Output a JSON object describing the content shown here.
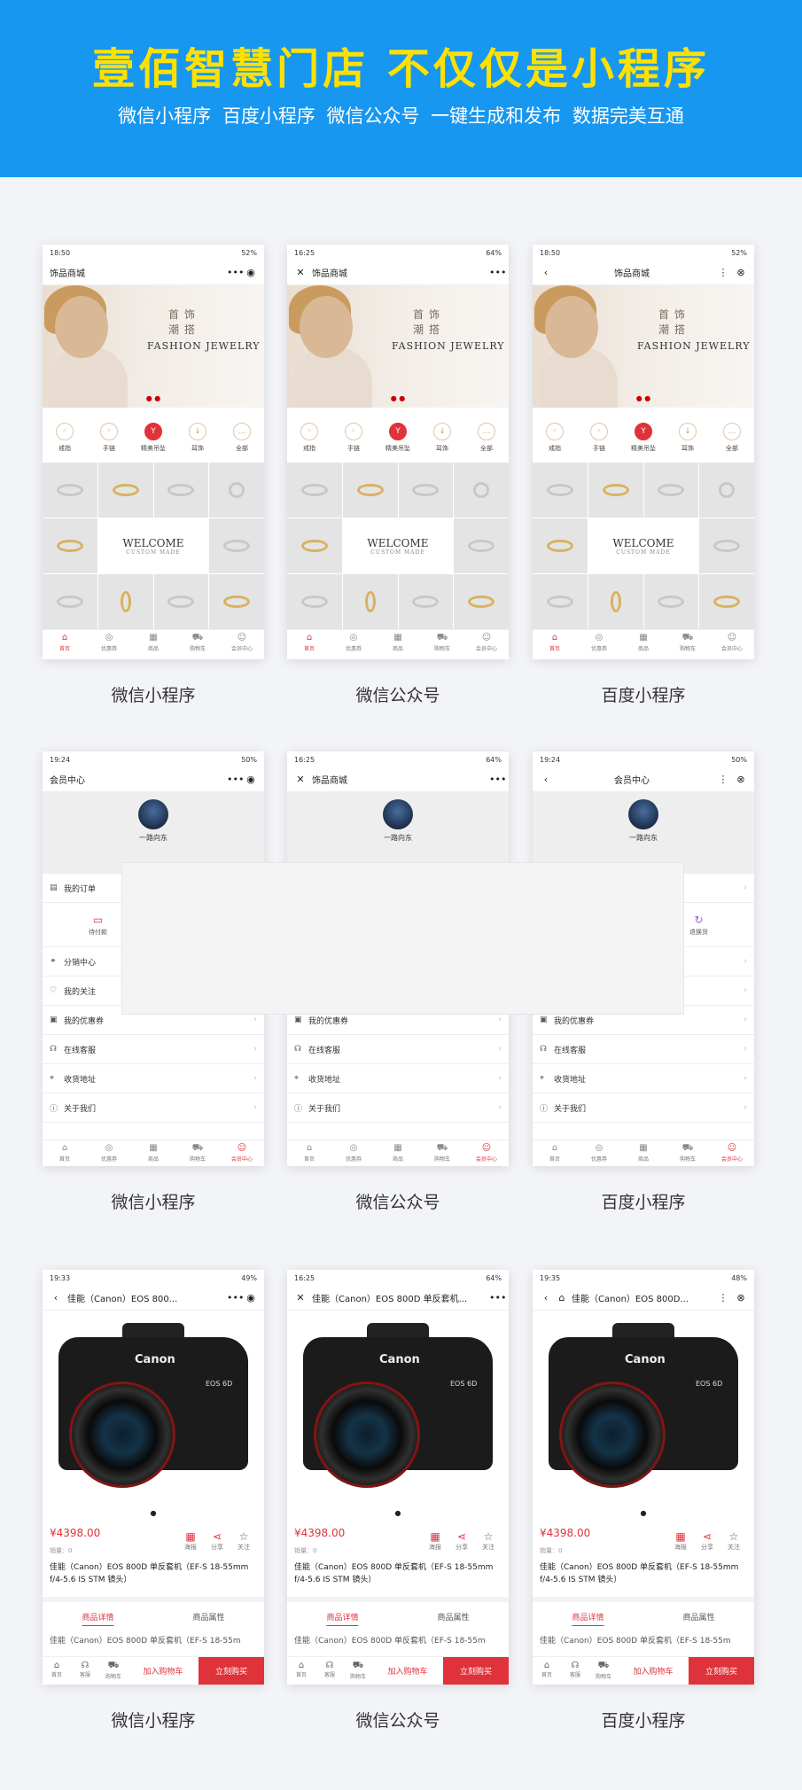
{
  "hero": {
    "title": "壹佰智慧门店 不仅仅是小程序",
    "subtitle": "微信小程序  百度小程序  微信公众号  一键生成和发布  数据完美互通"
  },
  "captions": {
    "wechat_mini": "微信小程序",
    "wechat_official": "微信公众号",
    "baidu_mini": "百度小程序"
  },
  "status": {
    "r1": {
      "c1": "18:50",
      "c2": "16:25",
      "c3": "18:50",
      "b1": "52%",
      "b2": "64%",
      "b3": "52%"
    },
    "r2": {
      "c1": "19:24",
      "c2": "16:25",
      "c3": "19:24",
      "b1": "50%",
      "b2": "64%",
      "b3": "50%"
    },
    "r3": {
      "c1": "19:33",
      "c2": "16:25",
      "c3": "19:35",
      "b1": "49%",
      "b2": "64%",
      "b3": "48%"
    }
  },
  "shop": {
    "title": "饰品商城",
    "banner_cn": "首饰潮搭",
    "banner_en": "FASHION JEWELRY",
    "cats": [
      "戒指",
      "手链",
      "精美吊坠",
      "耳饰",
      "全部"
    ],
    "welcome": "WELCOME",
    "custom": "CUSTOM MADE"
  },
  "tabs": [
    "首页",
    "优惠券",
    "商品",
    "购物车",
    "会员中心"
  ],
  "member": {
    "title": "会员中心",
    "name": "一路向东",
    "my_orders": "我的订单",
    "pending_pay": "待付款",
    "returns": "退换货",
    "rows": [
      "分销中心",
      "我的关注",
      "我的优惠券",
      "在线客服",
      "收货地址",
      "关于我们"
    ]
  },
  "product": {
    "nav_title_1": "佳能（Canon）EOS 800...",
    "nav_title_2": "佳能（Canon）EOS 800D 单反套机...",
    "nav_title_3": "佳能（Canon）EOS 800D...",
    "brand": "Canon",
    "model": "EOS 6D",
    "price": "¥4398.00",
    "sales": "销量：0",
    "poster": "海报",
    "share": "分享",
    "follow": "关注",
    "title": "佳能（Canon）EOS 800D 单反套机（EF-S 18-55mm f/4-5.6 IS STM 镜头）",
    "tab_detail": "商品详情",
    "tab_attr": "商品属性",
    "desc": "佳能（Canon）EOS 800D 单反套机（EF-S 18-55m",
    "home": "首页",
    "service": "客服",
    "cart": "购物车",
    "add_cart": "加入购物车",
    "buy_now": "立刻购买"
  }
}
